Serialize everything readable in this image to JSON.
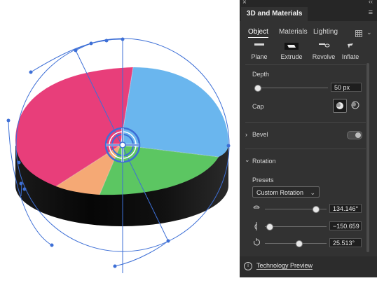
{
  "panel": {
    "title": "3D and Materials",
    "tabs": [
      "Object",
      "Materials",
      "Lighting"
    ],
    "shapes": [
      "Plane",
      "Extrude",
      "Revolve",
      "Inflate"
    ],
    "depth": {
      "label": "Depth",
      "value": "50 px",
      "level": 0.0
    },
    "cap_label": "Cap",
    "bevel_label": "Bevel",
    "rotation_label": "Rotation",
    "presets_label": "Presets",
    "preset_value": "Custom Rotation",
    "rotation_values": [
      "134.146°",
      "−150.659",
      "25.513°"
    ],
    "footer": "Technology Preview"
  },
  "colors": {
    "pink": "#e83e7a",
    "blue": "#6ab6ee",
    "green": "#5cc662",
    "orange": "#f5a975",
    "selection": "#3d6fd6",
    "panel_bg": "#323232"
  },
  "icons": [
    "close-icon",
    "collapse-icon",
    "panel-menu-icon",
    "grid-icon",
    "chevron-down-icon",
    "info-icon",
    "rotate-x-icon",
    "rotate-y-icon",
    "rotate-z-icon"
  ]
}
